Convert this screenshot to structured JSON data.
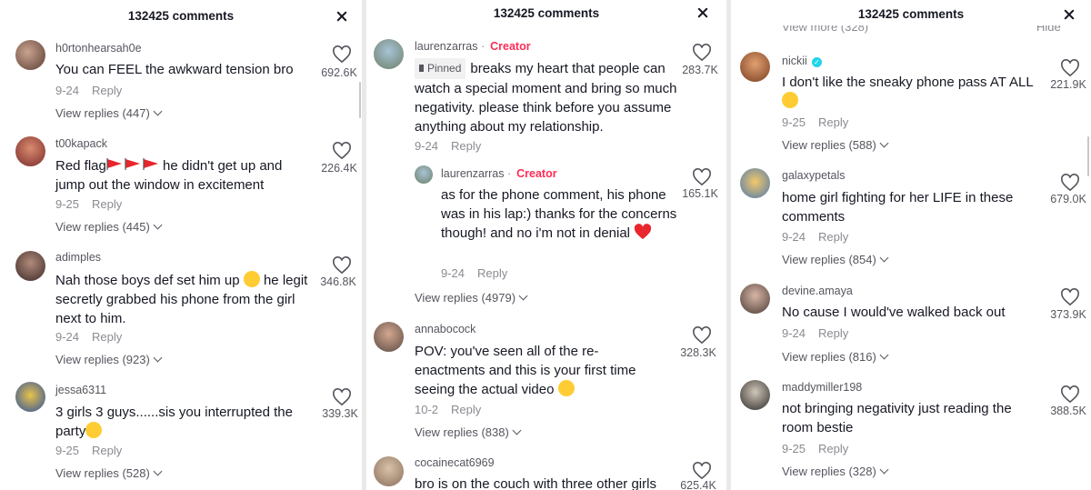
{
  "panels": [
    {
      "title": "132425 comments",
      "comments": [
        {
          "username": "h0rtonhearsah0e",
          "text": "You can FEEL the awkward tension bro",
          "date": "9-24",
          "reply": "Reply",
          "likes": "692.6K",
          "view_replies": "View replies (447)"
        },
        {
          "username": "t00kapack",
          "text_a": "Red flag",
          "text_b": " he didn't get up and jump out the window in excitement",
          "date": "9-25",
          "reply": "Reply",
          "likes": "226.4K",
          "view_replies": "View replies (445)"
        },
        {
          "username": "adimples",
          "text_a": "Nah those boys def set him up ",
          "text_b": " he legit secretly grabbed his phone from the girl next to him.",
          "date": "9-24",
          "reply": "Reply",
          "likes": "346.8K",
          "view_replies": "View replies (923)"
        },
        {
          "username": "jessa6311",
          "text": "3 girls 3 guys......sis you interrupted the party",
          "date": "9-25",
          "reply": "Reply",
          "likes": "339.3K",
          "view_replies": "View replies (528)"
        }
      ]
    },
    {
      "title": "132425 comments",
      "comments": [
        {
          "username": "laurenzarras",
          "badge": "Creator",
          "pinned": "Pinned",
          "text": "breaks my heart that people can watch a special moment and bring so much negativity. please think before you assume anything about my relationship.",
          "date": "9-24",
          "reply": "Reply",
          "likes": "283.7K"
        },
        {
          "username": "laurenzarras",
          "badge": "Creator",
          "text": "as for the phone comment, his phone was in his lap:) thanks for the concerns though! and no i'm not in denial",
          "date": "9-24",
          "reply": "Reply",
          "likes": "165.1K",
          "view_replies": "View replies (4979)"
        },
        {
          "username": "annabocock",
          "text": "POV: you've seen all of the re-enactments and this is your first time seeing the actual video",
          "date": "10-2",
          "reply": "Reply",
          "likes": "328.3K",
          "view_replies": "View replies (838)"
        },
        {
          "username": "cocainecat6969",
          "text": "bro is on the couch with three other girls",
          "likes": "625.4K"
        }
      ]
    },
    {
      "title": "132425 comments",
      "top_cut_left": "View more (328)",
      "top_cut_right": "Hide",
      "comments": [
        {
          "username": "nickii",
          "text": "I don't like the sneaky phone pass AT ALL",
          "date": "9-25",
          "reply": "Reply",
          "likes": "221.9K",
          "view_replies": "View replies (588)"
        },
        {
          "username": "galaxypetals",
          "text": "home girl fighting for her LIFE in these comments",
          "date": "9-24",
          "reply": "Reply",
          "likes": "679.0K",
          "view_replies": "View replies (854)"
        },
        {
          "username": "devine.amaya",
          "text": "No cause I would've walked back out",
          "date": "9-24",
          "reply": "Reply",
          "likes": "373.9K",
          "view_replies": "View replies (816)"
        },
        {
          "username": "maddymiller198",
          "text": "not bringing negativity just reading the room bestie",
          "date": "9-25",
          "reply": "Reply",
          "likes": "388.5K",
          "view_replies": "View replies (328)"
        }
      ]
    }
  ],
  "colors": {
    "creator": "#fe2c55",
    "verified": "#20d5ec",
    "flag": "#e8262c",
    "heart_emoji": "#e8262c"
  }
}
